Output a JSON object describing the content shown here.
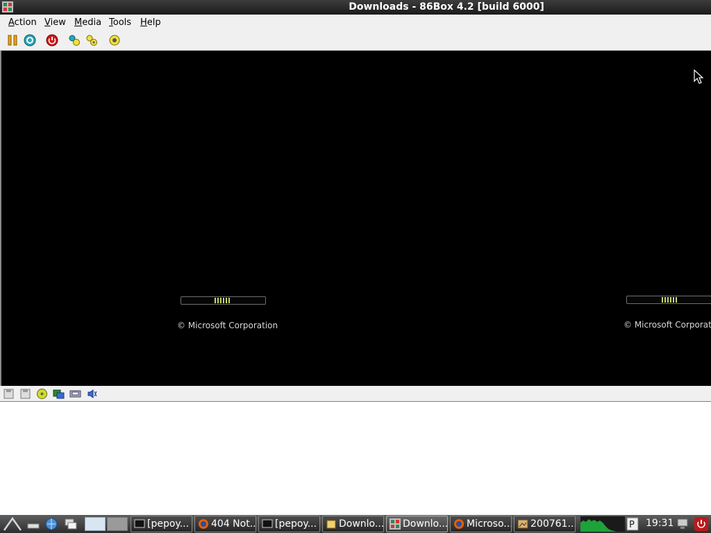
{
  "window": {
    "title": "Downloads - 86Box 4.2 [build 6000]"
  },
  "menu": [
    {
      "label": "Action",
      "accel": "A",
      "rest": "ction"
    },
    {
      "label": "View",
      "accel": "V",
      "rest": "iew"
    },
    {
      "label": "Media",
      "accel": "M",
      "rest": "edia"
    },
    {
      "label": "Tools",
      "accel": "T",
      "rest": "ools"
    },
    {
      "label": "Help",
      "accel": "H",
      "rest": "elp"
    }
  ],
  "toolbar": [
    "pause-icon",
    "reset-icon",
    "power-icon",
    "ctrl-alt-del-icon",
    "ctrl-alt-esc-icon",
    "settings-icon"
  ],
  "screen": {
    "copyright_left": "© Microsoft Corporation",
    "copyright_right": "© Microsoft Corporation"
  },
  "statusbar": [
    "floppy-1-icon",
    "floppy-2-icon",
    "cdrom-icon",
    "hard-disk-icon",
    "network-icon",
    "sound-icon"
  ],
  "taskbar": {
    "tasks": [
      {
        "label": "[pepoy...",
        "icon": "terminal-icon"
      },
      {
        "label": "404 Not...",
        "icon": "firefox-icon"
      },
      {
        "label": "[pepoy...",
        "icon": "terminal-icon"
      },
      {
        "label": "Downlo...",
        "icon": "folder-icon"
      },
      {
        "label": "Downlo...",
        "icon": "86box-icon"
      },
      {
        "label": "Microso...",
        "icon": "firefox-icon"
      },
      {
        "label": "200761...",
        "icon": "image-viewer-icon"
      }
    ],
    "clock": "19:31"
  },
  "colors": {
    "titlebar": "#2a2a2a",
    "screen": "#000000",
    "progress": "#c8d66a",
    "taskbar": "#3a3a3a"
  }
}
